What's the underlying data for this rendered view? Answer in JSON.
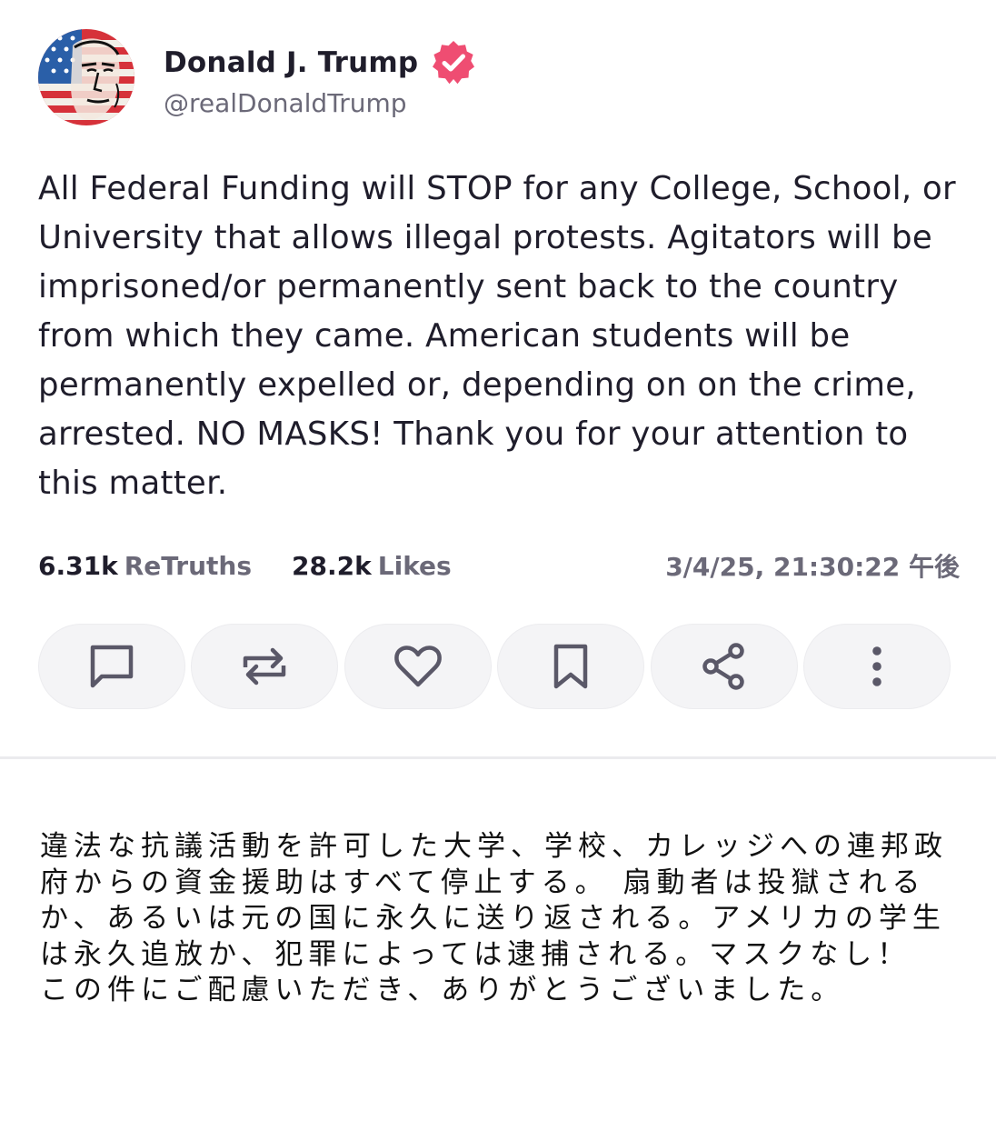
{
  "author": {
    "display_name": "Donald J. Trump",
    "handle": "@realDonaldTrump",
    "verified_color": "#ef4d72"
  },
  "post": {
    "text": "All Federal Funding will STOP for any College, School, or University that allows illegal protests. Agitators will be imprisoned/or permanently sent back to the country from which they came. American students will be permanently expelled or, depending on on the crime, arrested. NO MASKS! Thank you for your attention to this matter."
  },
  "stats": {
    "retruths_count": "6.31k",
    "retruths_label": "ReTruths",
    "likes_count": "28.2k",
    "likes_label": "Likes",
    "timestamp": "3/4/25, 21:30:22 午後"
  },
  "actions": [
    {
      "icon": "reply-icon"
    },
    {
      "icon": "retruth-icon"
    },
    {
      "icon": "heart-icon"
    },
    {
      "icon": "bookmark-icon"
    },
    {
      "icon": "share-icon"
    },
    {
      "icon": "more-vertical-icon"
    }
  ],
  "translation": {
    "text": "違法な抗議活動を許可した大学、学校、カレッジへの連邦政府からの資金援助はすべて停止する。 扇動者は投獄されるか、あるいは元の国に永久に送り返される。アメリカの学生は永久追放か、犯罪によっては逮捕される。マスクなし！ この件にご配慮いただき、ありがとうございました。"
  },
  "colors": {
    "text_primary": "#1f1d2b",
    "text_secondary": "#6b6978",
    "button_bg": "#f4f4f6",
    "icon": "#5a5868"
  }
}
